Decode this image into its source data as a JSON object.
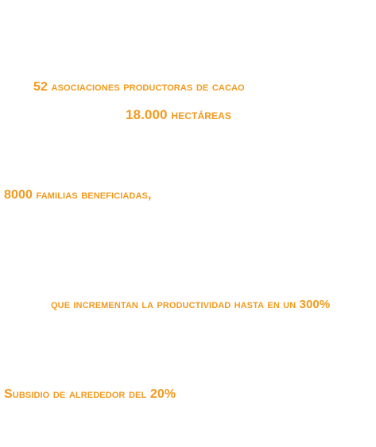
{
  "lines": {
    "associations": "52 asociaciones productoras de cacao",
    "hectares": "18.000 hectáreas",
    "families": "8000 familias beneficiadas,",
    "productivity": "que incrementan la productividad hasta en un 300%",
    "subsidy": "Subsidio de alrededor del 20%"
  },
  "colors": {
    "text": "#f39a1e",
    "background": "#ffffff"
  }
}
